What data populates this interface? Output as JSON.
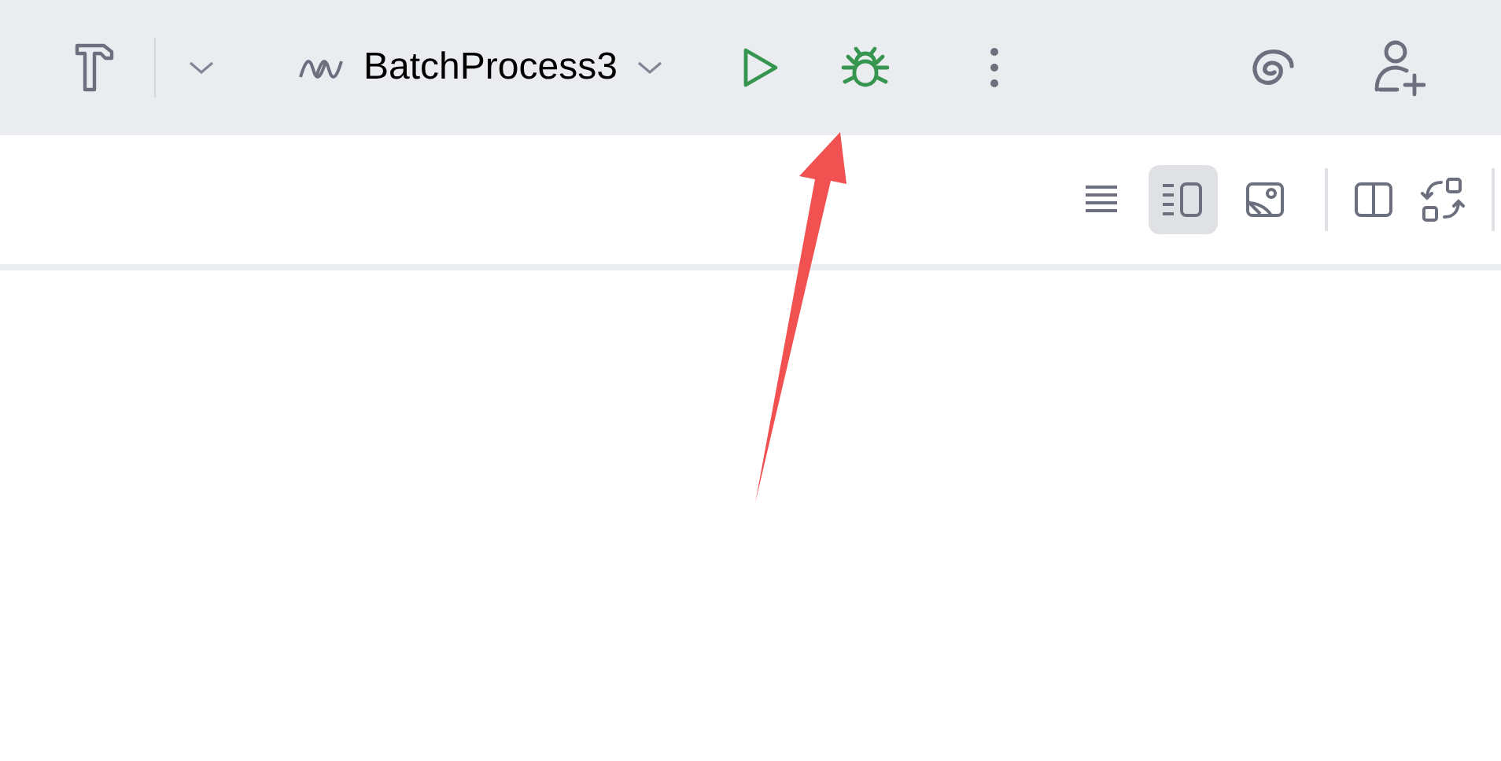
{
  "toolbar": {
    "run_configuration": "BatchProcess3"
  },
  "editor_toolbar": {
    "view_modes": [
      {
        "kind": "code",
        "selected": false
      },
      {
        "kind": "split",
        "selected": true
      },
      {
        "kind": "design",
        "selected": false
      }
    ]
  }
}
